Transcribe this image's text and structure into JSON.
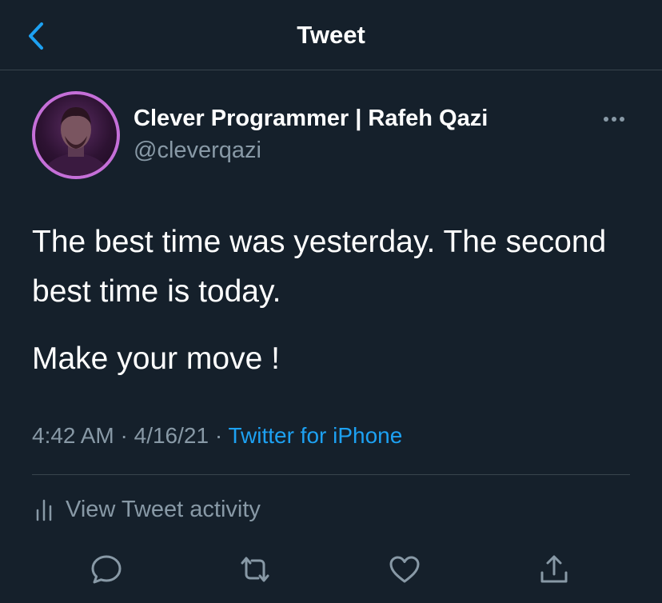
{
  "header": {
    "title": "Tweet"
  },
  "tweet": {
    "author_name": "Clever Programmer | Rafeh Qazi",
    "author_handle": "@cleverqazi",
    "text_line1": "The best time was yesterday. The second best time is today.",
    "text_line2": "Make your move !",
    "time": "4:42 AM",
    "separator": "·",
    "date": "4/16/21",
    "source": "Twitter for iPhone"
  },
  "activity": {
    "label": "View Tweet activity"
  },
  "colors": {
    "background": "#15202b",
    "accent": "#1da1f2",
    "secondary_text": "#8899a6",
    "divider": "#38444d",
    "avatar_ring": "#c56fd8"
  },
  "icons": {
    "back": "chevron-left-icon",
    "more": "more-horizontal-icon",
    "activity": "bar-chart-icon",
    "reply": "reply-icon",
    "retweet": "retweet-icon",
    "like": "heart-icon",
    "share": "share-icon"
  }
}
